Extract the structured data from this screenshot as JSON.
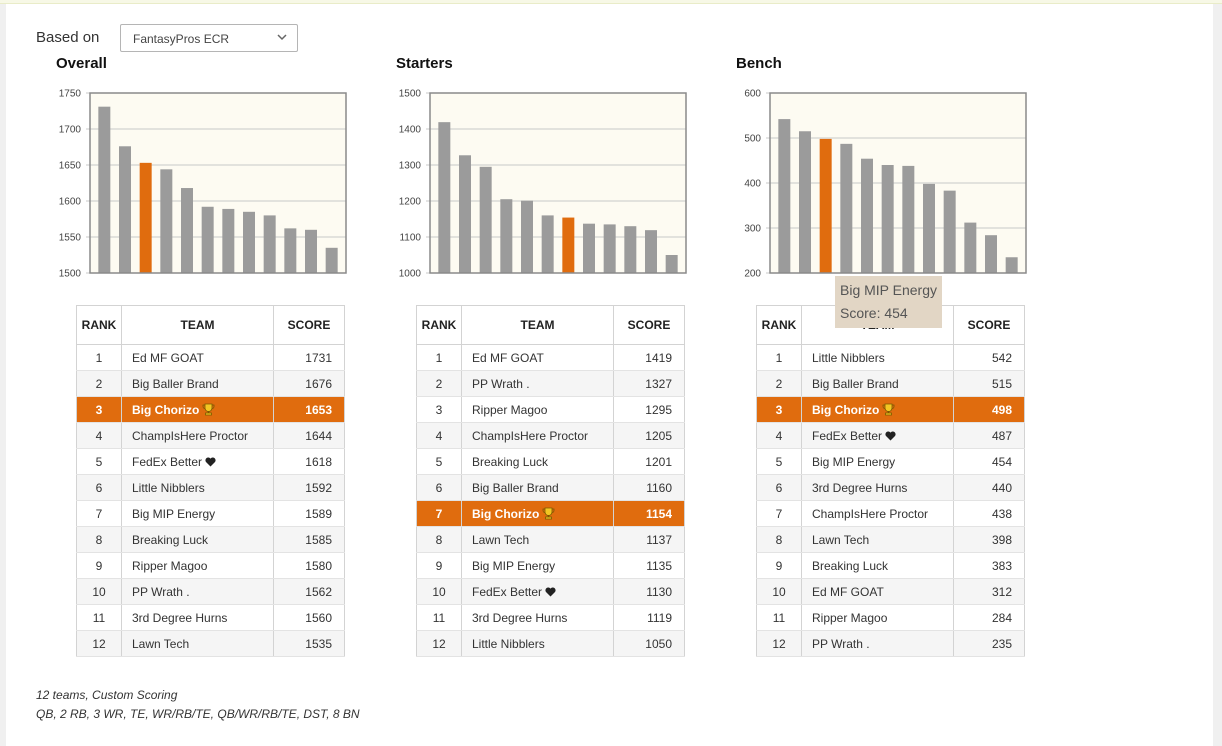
{
  "controls": {
    "based_on_label": "Based on",
    "based_on_value": "FantasyPros ECR"
  },
  "colors": {
    "bar": "#9b9b9b",
    "highlight": "#e06c0e",
    "plot_bg": "#fdfbf2",
    "tooltip_bg": "#e2d6c5"
  },
  "icons": {
    "select": "chevron-down-icon",
    "trophy": "trophy-icon",
    "heart": "heart-icon"
  },
  "table_headers": {
    "rank": "RANK",
    "team": "TEAM",
    "score": "SCORE"
  },
  "tooltip": {
    "title": "Big MIP Energy",
    "score_label": "Score: 454"
  },
  "footer": {
    "line1": "12 teams, Custom Scoring",
    "line2": "QB, 2 RB, 3 WR, TE, WR/RB/TE, QB/WR/RB/TE, DST, 8 BN"
  },
  "chart_data": [
    {
      "title": "Overall",
      "type": "bar",
      "ylim": [
        1500,
        1750
      ],
      "yticks": [
        "1500",
        "1550",
        "1600",
        "1650",
        "1700",
        "1750"
      ],
      "highlight_index": 2,
      "rows": [
        {
          "rank": "1",
          "team": "Ed MF GOAT",
          "score": "1731"
        },
        {
          "rank": "2",
          "team": "Big Baller Brand",
          "score": "1676"
        },
        {
          "rank": "3",
          "team": "Big Chorizo",
          "score": "1653",
          "trophy": true
        },
        {
          "rank": "4",
          "team": "ChampIsHere Proctor",
          "score": "1644"
        },
        {
          "rank": "5",
          "team": "FedEx Better",
          "score": "1618",
          "heart": true
        },
        {
          "rank": "6",
          "team": "Little Nibblers",
          "score": "1592"
        },
        {
          "rank": "7",
          "team": "Big MIP Energy",
          "score": "1589"
        },
        {
          "rank": "8",
          "team": "Breaking Luck",
          "score": "1585"
        },
        {
          "rank": "9",
          "team": "Ripper Magoo",
          "score": "1580"
        },
        {
          "rank": "10",
          "team": "PP Wrath .",
          "score": "1562"
        },
        {
          "rank": "11",
          "team": "3rd Degree Hurns",
          "score": "1560"
        },
        {
          "rank": "12",
          "team": "Lawn Tech",
          "score": "1535"
        }
      ]
    },
    {
      "title": "Starters",
      "type": "bar",
      "ylim": [
        1000,
        1500
      ],
      "yticks": [
        "1000",
        "1100",
        "1200",
        "1300",
        "1400",
        "1500"
      ],
      "highlight_index": 6,
      "rows": [
        {
          "rank": "1",
          "team": "Ed MF GOAT",
          "score": "1419"
        },
        {
          "rank": "2",
          "team": "PP Wrath .",
          "score": "1327"
        },
        {
          "rank": "3",
          "team": "Ripper Magoo",
          "score": "1295"
        },
        {
          "rank": "4",
          "team": "ChampIsHere Proctor",
          "score": "1205"
        },
        {
          "rank": "5",
          "team": "Breaking Luck",
          "score": "1201"
        },
        {
          "rank": "6",
          "team": "Big Baller Brand",
          "score": "1160"
        },
        {
          "rank": "7",
          "team": "Big Chorizo",
          "score": "1154",
          "trophy": true
        },
        {
          "rank": "8",
          "team": "Lawn Tech",
          "score": "1137"
        },
        {
          "rank": "9",
          "team": "Big MIP Energy",
          "score": "1135"
        },
        {
          "rank": "10",
          "team": "FedEx Better",
          "score": "1130",
          "heart": true
        },
        {
          "rank": "11",
          "team": "3rd Degree Hurns",
          "score": "1119"
        },
        {
          "rank": "12",
          "team": "Little Nibblers",
          "score": "1050"
        }
      ]
    },
    {
      "title": "Bench",
      "type": "bar",
      "ylim": [
        200,
        600
      ],
      "yticks": [
        "200",
        "300",
        "400",
        "500",
        "600"
      ],
      "highlight_index": 2,
      "rows": [
        {
          "rank": "1",
          "team": "Little Nibblers",
          "score": "542"
        },
        {
          "rank": "2",
          "team": "Big Baller Brand",
          "score": "515"
        },
        {
          "rank": "3",
          "team": "Big Chorizo",
          "score": "498",
          "trophy": true
        },
        {
          "rank": "4",
          "team": "FedEx Better",
          "score": "487",
          "heart": true
        },
        {
          "rank": "5",
          "team": "Big MIP Energy",
          "score": "454"
        },
        {
          "rank": "6",
          "team": "3rd Degree Hurns",
          "score": "440"
        },
        {
          "rank": "7",
          "team": "ChampIsHere Proctor",
          "score": "438"
        },
        {
          "rank": "8",
          "team": "Lawn Tech",
          "score": "398"
        },
        {
          "rank": "9",
          "team": "Breaking Luck",
          "score": "383"
        },
        {
          "rank": "10",
          "team": "Ed MF GOAT",
          "score": "312"
        },
        {
          "rank": "11",
          "team": "Ripper Magoo",
          "score": "284"
        },
        {
          "rank": "12",
          "team": "PP Wrath .",
          "score": "235"
        }
      ]
    }
  ]
}
